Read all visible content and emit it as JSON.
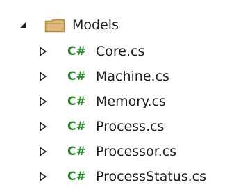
{
  "explorer": {
    "folder": {
      "name": "Models",
      "expanded": true,
      "icon": "folder-icon",
      "expander_icon": "expanded-triangle-icon"
    },
    "files": [
      {
        "name": "Core.cs",
        "badge": "C#"
      },
      {
        "name": "Machine.cs",
        "badge": "C#"
      },
      {
        "name": "Memory.cs",
        "badge": "C#"
      },
      {
        "name": "Process.cs",
        "badge": "C#"
      },
      {
        "name": "Processor.cs",
        "badge": "C#"
      },
      {
        "name": "ProcessStatus.cs",
        "badge": "C#"
      }
    ],
    "colors": {
      "csharp_badge": "#2f8a2f",
      "folder_fill": "#dcb67a",
      "text": "#1e1e1e",
      "expander": "#1e1e1e"
    }
  }
}
